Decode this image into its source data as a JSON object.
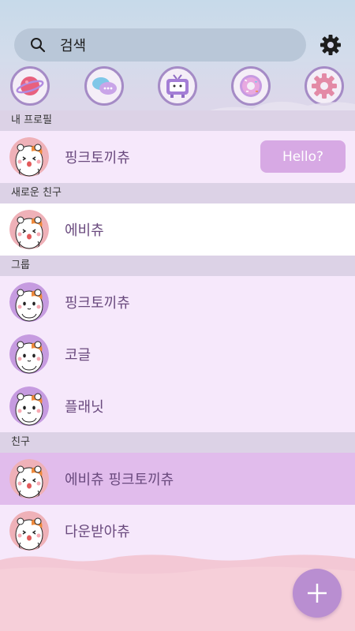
{
  "search": {
    "label": "검색",
    "icon": "search-icon"
  },
  "settings": {
    "icon": "gear-icon"
  },
  "quick_icons": [
    "planet-icon",
    "chat-bubbles-icon",
    "tv-icon",
    "donut-icon",
    "settings-gear-icon"
  ],
  "sections": {
    "my_profile": "내 프로필",
    "new_friends": "새로운 친구",
    "groups": "그룹",
    "friends": "친구"
  },
  "my_profile": {
    "name": "핑크토끼츄",
    "status_button": "Hello?"
  },
  "new_friends": [
    {
      "name": "에비츄"
    }
  ],
  "groups": [
    {
      "name": "핑크토끼츄"
    },
    {
      "name": "코글"
    },
    {
      "name": "플래닛"
    }
  ],
  "friends": [
    {
      "name": "에비츄 핑크토끼츄"
    },
    {
      "name": "다운받아츄"
    }
  ],
  "fab": {
    "icon": "plus-icon"
  },
  "colors": {
    "accent": "#d7a9e4",
    "selected_row": "#e1bcec",
    "row_bg": "#f6e8fb",
    "fab": "#b98ed1"
  }
}
